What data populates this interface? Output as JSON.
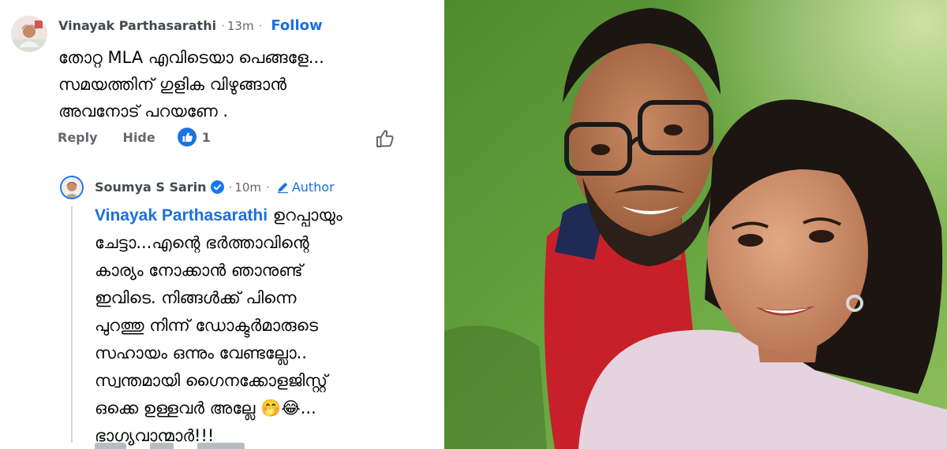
{
  "comment": {
    "author": "Vinayak Parthasarathi",
    "separator": "·",
    "age": "13m",
    "follow_label": "Follow",
    "avatar_icon": "profile-photo-icon",
    "lines": [
      "തോറ്റ MLA എവിടെയാ പെങ്ങളേ...",
      "സമയത്തിന് ഗുളിക വിഴുങ്ങാൻ",
      "അവനോട് പറയണേ ."
    ],
    "actions": {
      "reply_label": "Reply",
      "hide_label": "Hide",
      "reaction_icon": "like-reaction-icon",
      "reaction_count": "1",
      "like_icon": "thumbs-up-icon"
    }
  },
  "reply": {
    "author": "Soumya S Sarin",
    "verified_icon": "verified-badge-icon",
    "separator": "·",
    "age": "10m",
    "separator2": "·",
    "author_badge": "Author",
    "badge_icon": "pencil-icon",
    "mention": "Vinayak Parthasarathi",
    "first_line_rest": " ഉറപ്പായും",
    "lines": [
      "ചേട്ടാ...എന്റെ ഭർത്താവിന്റെ",
      "കാര്യം നോക്കാൻ ഞാനുണ്ട്",
      "ഇവിടെ. നിങ്ങൾക്ക് പിന്നെ",
      "പുറത്തു നിന്ന് ഡോക്ടർമാരുടെ",
      "സഹായം ഒന്നും വേണ്ടല്ലോ..",
      "സ്വന്തമായി ഗൈനക്കോളജിസ്റ്റ്",
      "ഒക്കെ ഉള്ളവർ അല്ലേ 🤭😂...",
      "ഭാഗ്യവാന്മാർ!!!"
    ]
  },
  "colors": {
    "link_blue": "#1b6fe0",
    "meta_gray": "#65676b",
    "text": "#050505",
    "grass": "#5f9a3c"
  }
}
